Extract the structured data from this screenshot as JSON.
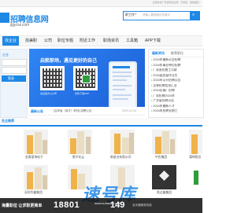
{
  "topbar": {
    "text": "全国本地厂家招聘信息网 · 手机版 · 微信服务"
  },
  "header": {
    "logo_title": "招聘信息网",
    "logo_url": "jlgycw.com"
  },
  "search": {
    "category": "职工作",
    "placeholder": "请输入要搜索的关键字"
  },
  "nav": {
    "items": [
      "找企业",
      "找兼职",
      "公司",
      "职位专题",
      "附近工作",
      "职场资讯",
      "工具箱",
      "APP下载"
    ]
  },
  "left_panel": {
    "label": "企业",
    "button": "登录"
  },
  "banner": {
    "title": "启航职场，遇见更好的自己",
    "qr_caption_1": "关注官方公众号",
    "qr_caption_2": "扫码下载APP"
  },
  "announcement": {
    "tag": "最新公告",
    "text": "[吉林省（英才）职场] 招聘公告",
    "date": "2024-12-24"
  },
  "right_panel": {
    "tabs": [
      "最新资讯",
      "推荐职位"
    ],
    "items": [
      "2024年最新公告招聘",
      "2024年事业单位招聘",
      "厂家直招普工月薪",
      "2024届应届毕业生",
      "2024年公开招聘公告",
      "吉林招聘信息汇总",
      "2024长春厂招聘",
      "厂家招聘2024年",
      "广东省招聘公告",
      "2024年最新人才",
      "2024年招聘长期工",
      "2024年1月招聘会"
    ]
  },
  "section": {
    "title": "名企推荐"
  },
  "cards_row1": [
    "金属星海电子",
    "数字化云",
    "制造业有限公司",
    "中农集团",
    "蒲坤股份"
  ],
  "cards_row2": [
    "深圳华鑫集团",
    "",
    "",
    "",
    "奥达鑫集团"
  ],
  "bottom_bar": {
    "label": "海量职位 让求职更简单",
    "phone": "18801",
    "phone_tail": "149",
    "note": "全天候服务热线"
  },
  "watermark": {
    "text": "速号库",
    "sub": "www.suhaoku.com"
  }
}
